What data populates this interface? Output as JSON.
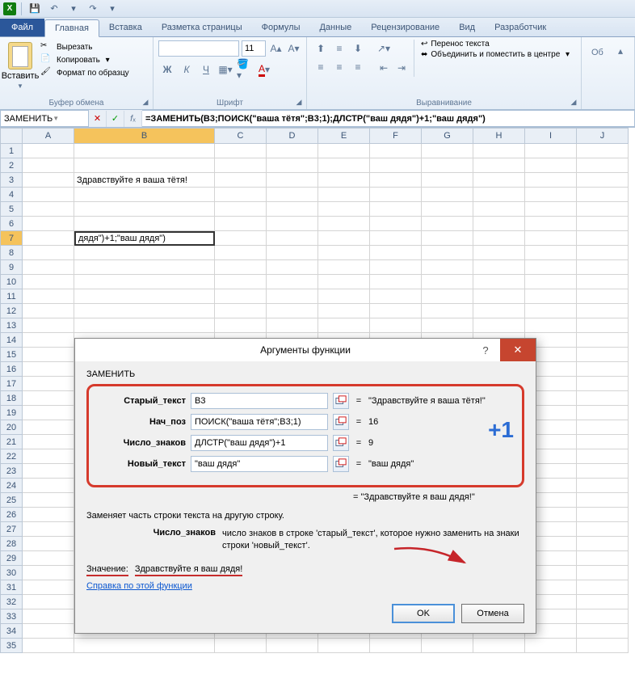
{
  "qat": {
    "save": "💾",
    "undo": "↶",
    "redo": "↷"
  },
  "tabs": {
    "file": "Файл",
    "list": [
      "Главная",
      "Вставка",
      "Разметка страницы",
      "Формулы",
      "Данные",
      "Рецензирование",
      "Вид",
      "Разработчик"
    ],
    "active": 0
  },
  "ribbon": {
    "clipboard": {
      "label": "Буфер обмена",
      "paste": "Вставить",
      "cut": "Вырезать",
      "copy": "Копировать",
      "format_painter": "Формат по образцу"
    },
    "font": {
      "label": "Шрифт",
      "family": "",
      "size": "11",
      "bold": "Ж",
      "italic": "К",
      "underline": "Ч"
    },
    "align": {
      "label": "Выравнивание",
      "wrap": "Перенос текста",
      "merge": "Объединить и поместить в центре"
    }
  },
  "formula_bar": {
    "name": "ЗАМЕНИТЬ",
    "formula": "=ЗАМЕНИТЬ(B3;ПОИСК(\"ваша тётя\";B3;1);ДЛСТР(\"ваш дядя\")+1;\"ваш дядя\")"
  },
  "columns": [
    "A",
    "B",
    "C",
    "D",
    "E",
    "F",
    "G",
    "H",
    "I",
    "J"
  ],
  "rows_count": 35,
  "cells": {
    "B3": "Здравствуйте я ваша тётя!",
    "B7_display": "дядя\")+1;\"ваш дядя\")"
  },
  "active_cell": {
    "col": "B",
    "row": 7
  },
  "dialog": {
    "title": "Аргументы функции",
    "fn": "ЗАМЕНИТЬ",
    "args": [
      {
        "label": "Старый_текст",
        "input": "B3",
        "result": "\"Здравствуйте я ваша тётя!\""
      },
      {
        "label": "Нач_поз",
        "input": "ПОИСК(\"ваша тётя\";B3;1)",
        "result": "16"
      },
      {
        "label": "Число_знаков",
        "input": "ДЛСТР(\"ваш дядя\")+1",
        "result": "9"
      },
      {
        "label": "Новый_текст",
        "input": "\"ваш дядя\"",
        "result": "\"ваш дядя\""
      }
    ],
    "annotation": "+1",
    "overall_result": "\"Здравствуйте я ваш дядя!\"",
    "description": "Заменяет часть строки текста на другую строку.",
    "arg_desc_label": "Число_знаков",
    "arg_desc_text": "число знаков в строке 'старый_текст', которое нужно заменить на знаки строки 'новый_текст'.",
    "value_label": "Значение:",
    "value": "Здравствуйте я ваш дядя!",
    "help": "Справка по этой функции",
    "ok": "OK",
    "cancel": "Отмена"
  }
}
